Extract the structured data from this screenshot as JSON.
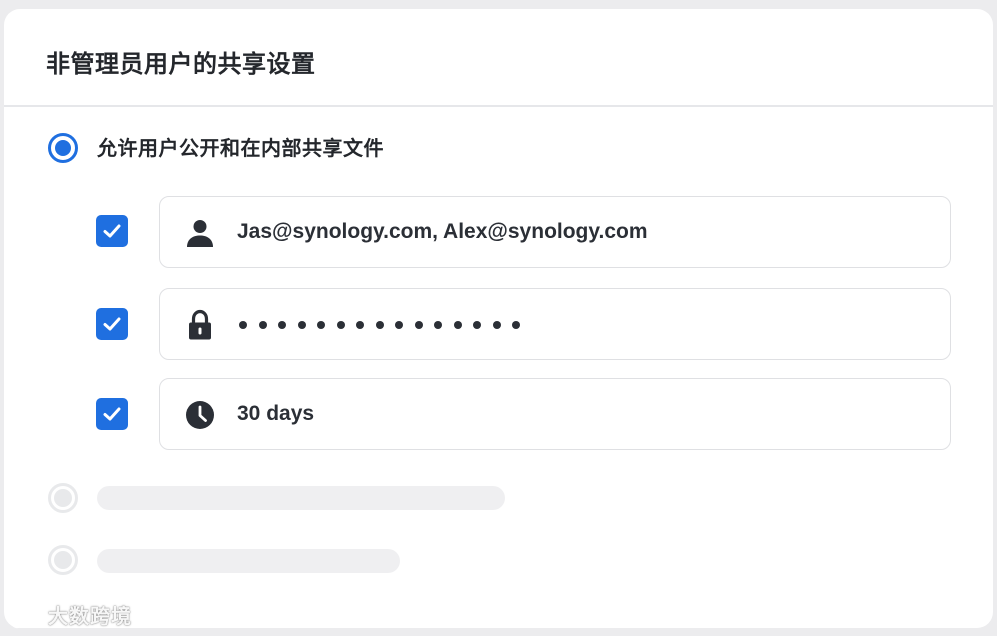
{
  "panel": {
    "title": "非管理员用户的共享设置"
  },
  "options": [
    {
      "label": "允许用户公开和在内部共享文件",
      "selected": true,
      "sub_settings": [
        {
          "checked": true,
          "icon": "user-icon",
          "value": "Jas@synology.com, Alex@synology.com"
        },
        {
          "checked": true,
          "icon": "lock-icon",
          "value": "",
          "masked_char_count": 15
        },
        {
          "checked": true,
          "icon": "clock-icon",
          "value": "30 days"
        }
      ]
    },
    {
      "label": "",
      "selected": false
    },
    {
      "label": "",
      "selected": false
    }
  ],
  "watermark": {
    "text": "大数跨境"
  },
  "colors": {
    "accent": "#1f6fe0",
    "text": "#24272c",
    "border": "#dfe0e3",
    "placeholder": "#efeff1"
  }
}
